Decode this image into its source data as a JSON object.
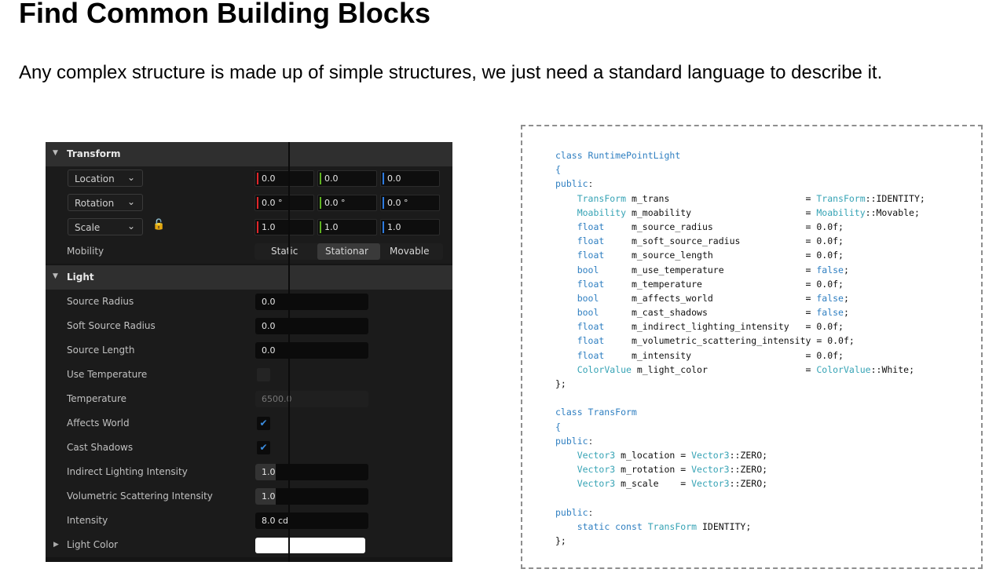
{
  "slide": {
    "title": "Find Common Building Blocks",
    "subtitle": "Any complex structure is made up of simple structures, we just need a standard language to describe it."
  },
  "panel": {
    "transform": {
      "header": "Transform",
      "location": {
        "label": "Location",
        "x": "0.0",
        "y": "0.0",
        "z": "0.0"
      },
      "rotation": {
        "label": "Rotation",
        "x": "0.0 °",
        "y": "0.0 °",
        "z": "0.0 °"
      },
      "scale": {
        "label": "Scale",
        "x": "1.0",
        "y": "1.0",
        "z": "1.0"
      },
      "mobility": {
        "label": "Mobility",
        "options": [
          "Static",
          "Stationar",
          "Movable"
        ],
        "selected": "Stationar"
      }
    },
    "light": {
      "header": "Light",
      "source_radius": {
        "label": "Source Radius",
        "value": "0.0"
      },
      "soft_source_radius": {
        "label": "Soft Source Radius",
        "value": "0.0"
      },
      "source_length": {
        "label": "Source Length",
        "value": "0.0"
      },
      "use_temperature": {
        "label": "Use Temperature",
        "checked": false
      },
      "temperature": {
        "label": "Temperature",
        "value": "6500.0"
      },
      "affects_world": {
        "label": "Affects World",
        "checked": true
      },
      "cast_shadows": {
        "label": "Cast Shadows",
        "checked": true
      },
      "indirect_lighting_intensity": {
        "label": "Indirect Lighting Intensity",
        "value": "1.0"
      },
      "volumetric_scattering_intensity": {
        "label": "Volumetric Scattering Intensity",
        "value": "1.0"
      },
      "intensity": {
        "label": "Intensity",
        "value": "8.0 cd"
      },
      "light_color": {
        "label": "Light Color",
        "color": "#ffffff"
      }
    },
    "colors": {
      "x_axis": "#e0262a",
      "y_axis": "#5fb322",
      "z_axis": "#2d7be0",
      "checkmark": "#3b8de0"
    }
  },
  "code": {
    "lines": [
      [
        [
          "blue",
          "class RuntimePointLight"
        ]
      ],
      [
        [
          "blue",
          "{"
        ]
      ],
      [
        [
          "blue",
          "public"
        ],
        [
          "",
          "ː"
        ]
      ],
      [
        [
          "",
          "    "
        ],
        [
          "teal",
          "TransForm"
        ],
        [
          "",
          " m_trans                         = "
        ],
        [
          "teal",
          "TransForm"
        ],
        [
          "",
          "::IDENTITY;"
        ]
      ],
      [
        [
          "",
          "    "
        ],
        [
          "teal",
          "Moability"
        ],
        [
          "",
          " m_moability                     = "
        ],
        [
          "teal",
          "Moability"
        ],
        [
          "",
          "::Movable;"
        ]
      ],
      [
        [
          "",
          "    "
        ],
        [
          "blue",
          "float"
        ],
        [
          "",
          "     m_source_radius                 = 0.0f;"
        ]
      ],
      [
        [
          "",
          "    "
        ],
        [
          "blue",
          "float"
        ],
        [
          "",
          "     m_soft_source_radius            = 0.0f;"
        ]
      ],
      [
        [
          "",
          "    "
        ],
        [
          "blue",
          "float"
        ],
        [
          "",
          "     m_source_length                 = 0.0f;"
        ]
      ],
      [
        [
          "",
          "    "
        ],
        [
          "blue",
          "bool"
        ],
        [
          "",
          "      m_use_temperature               = "
        ],
        [
          "blue",
          "false"
        ],
        [
          "",
          ";"
        ]
      ],
      [
        [
          "",
          "    "
        ],
        [
          "blue",
          "float"
        ],
        [
          "",
          "     m_temperature                   = 0.0f;"
        ]
      ],
      [
        [
          "",
          "    "
        ],
        [
          "blue",
          "bool"
        ],
        [
          "",
          "      m_affects_world                 = "
        ],
        [
          "blue",
          "false"
        ],
        [
          "",
          ";"
        ]
      ],
      [
        [
          "",
          "    "
        ],
        [
          "blue",
          "bool"
        ],
        [
          "",
          "      m_cast_shadows                  = "
        ],
        [
          "blue",
          "false"
        ],
        [
          "",
          ";"
        ]
      ],
      [
        [
          "",
          "    "
        ],
        [
          "blue",
          "float"
        ],
        [
          "",
          "     m_indirect_lighting_intensity   = 0.0f;"
        ]
      ],
      [
        [
          "",
          "    "
        ],
        [
          "blue",
          "float"
        ],
        [
          "",
          "     m_volumetric_scattering_intensity = 0.0f;"
        ]
      ],
      [
        [
          "",
          "    "
        ],
        [
          "blue",
          "float"
        ],
        [
          "",
          "     m_intensity                     = 0.0f;"
        ]
      ],
      [
        [
          "",
          "    "
        ],
        [
          "teal",
          "ColorValue"
        ],
        [
          "",
          " m_light_color                  = "
        ],
        [
          "teal",
          "ColorValue"
        ],
        [
          "",
          "::White;"
        ]
      ],
      [
        [
          "",
          "};"
        ]
      ],
      [
        [
          "",
          ""
        ]
      ],
      [
        [
          "blue",
          "class TransForm"
        ]
      ],
      [
        [
          "blue",
          "{"
        ]
      ],
      [
        [
          "blue",
          "public"
        ],
        [
          "",
          "ː"
        ]
      ],
      [
        [
          "",
          "    "
        ],
        [
          "teal",
          "Vector3"
        ],
        [
          "",
          " m_location = "
        ],
        [
          "teal",
          "Vector3"
        ],
        [
          "",
          "::ZERO;"
        ]
      ],
      [
        [
          "",
          "    "
        ],
        [
          "teal",
          "Vector3"
        ],
        [
          "",
          " m_rotation = "
        ],
        [
          "teal",
          "Vector3"
        ],
        [
          "",
          "::ZERO;"
        ]
      ],
      [
        [
          "",
          "    "
        ],
        [
          "teal",
          "Vector3"
        ],
        [
          "",
          " m_scale    = "
        ],
        [
          "teal",
          "Vector3"
        ],
        [
          "",
          "::ZERO;"
        ]
      ],
      [
        [
          "",
          ""
        ]
      ],
      [
        [
          "blue",
          "public"
        ],
        [
          "",
          "ː"
        ]
      ],
      [
        [
          "",
          "    "
        ],
        [
          "blue",
          "static const"
        ],
        [
          "",
          " "
        ],
        [
          "teal",
          "TransForm"
        ],
        [
          "",
          " IDENTITY;"
        ]
      ],
      [
        [
          "",
          "};"
        ]
      ]
    ]
  }
}
